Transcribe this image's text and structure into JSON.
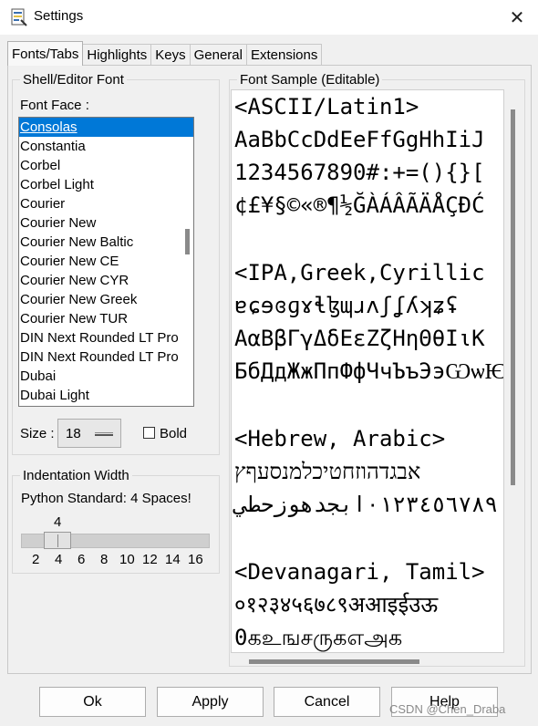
{
  "window": {
    "title": "Settings",
    "close_glyph": "✕"
  },
  "tabs": [
    {
      "label": "Fonts/Tabs",
      "active": true
    },
    {
      "label": "Highlights",
      "active": false
    },
    {
      "label": "Keys",
      "active": false
    },
    {
      "label": "General",
      "active": false
    },
    {
      "label": "Extensions",
      "active": false
    }
  ],
  "shell_font": {
    "group_label": "Shell/Editor Font",
    "font_face_label": "Font Face :",
    "fonts": [
      "Consolas",
      "Constantia",
      "Corbel",
      "Corbel Light",
      "Courier",
      "Courier New",
      "Courier New Baltic",
      "Courier New CE",
      "Courier New CYR",
      "Courier New Greek",
      "Courier New TUR",
      "DIN Next Rounded LT Pro",
      "DIN Next Rounded LT Pro",
      "Dubai",
      "Dubai Light"
    ],
    "selected_font": "Consolas",
    "size_label": "Size :",
    "size_value": "18",
    "bold_label": "Bold",
    "bold_checked": false
  },
  "indentation": {
    "group_label": "Indentation Width",
    "standard_text": "Python Standard: 4 Spaces!",
    "current_value": "4",
    "tick_labels": [
      "2",
      "4",
      "6",
      "8",
      "10",
      "12",
      "14",
      "16"
    ]
  },
  "font_sample": {
    "group_label": "Font Sample (Editable)",
    "lines": [
      "<ASCII/Latin1>",
      "AaBbCcDdEeFfGgHhIiJ",
      "1234567890#:+=(){}[",
      "¢£¥§©«®¶½ĞÀÁÂÃÄÅÇĐĆ",
      "",
      "<IPA,Greek,Cyrillic",
      "ɐɕɘɞɡɤɬɮɰɹʌʃʆʎʞʑʢ",
      "ΑαΒβΓγΔδΕεΖζΗηΘθΙιΚ",
      "БбДдЖжПпФфЧчЪъЭэѠѡѤ",
      "",
      "<Hebrew, Arabic>",
      "אבגדהוזחטיכלמנסעףץ",
      "٠١٢٣٤٥٦٧٨٩ابجدهوزحطي",
      "",
      "<Devanagari, Tamil>",
      "०१२३४५६७८९अआइईउऊ",
      "0கஉஙசருகஎஅக"
    ]
  },
  "buttons": {
    "ok": "Ok",
    "apply": "Apply",
    "cancel": "Cancel",
    "help": "Help"
  },
  "watermark": "CSDN @Chen_Draba"
}
